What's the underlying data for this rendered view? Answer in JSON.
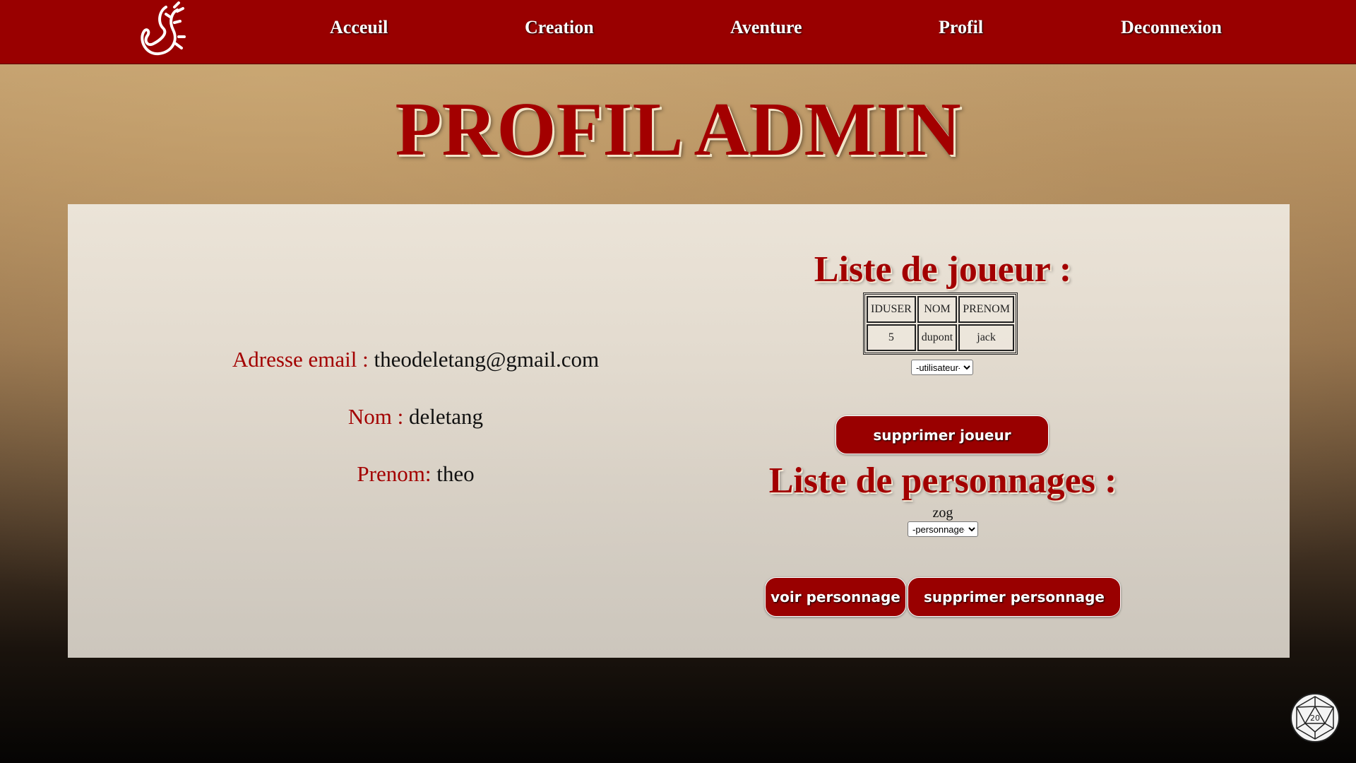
{
  "nav": {
    "items": [
      "Acceuil",
      "Creation",
      "Aventure",
      "Profil",
      "Deconnexion"
    ]
  },
  "page": {
    "title": "PROFIL ADMIN"
  },
  "profile": {
    "email_label": "Adresse email :",
    "email_value": "theodeletang@gmail.com",
    "nom_label": "Nom :",
    "nom_value": "deletang",
    "prenom_label": "Prenom:",
    "prenom_value": "theo"
  },
  "players": {
    "title": "Liste de joueur :",
    "columns": [
      "IDUSER",
      "NOM",
      "PRENOM"
    ],
    "rows": [
      [
        "5",
        "dupont",
        "jack"
      ]
    ],
    "select_value": "-utilisateur-",
    "delete_button": "supprimer joueur"
  },
  "characters": {
    "title": "Liste de personnages :",
    "names": [
      "zog"
    ],
    "select_value": "-personnage-",
    "view_button": "voir personnage",
    "delete_button": "supprimer personnage"
  },
  "colors": {
    "brand_red": "#990000",
    "title_red": "#a30000"
  },
  "icons": {
    "logo": "salamander-logo-icon",
    "dice": "d20-dice-icon"
  }
}
